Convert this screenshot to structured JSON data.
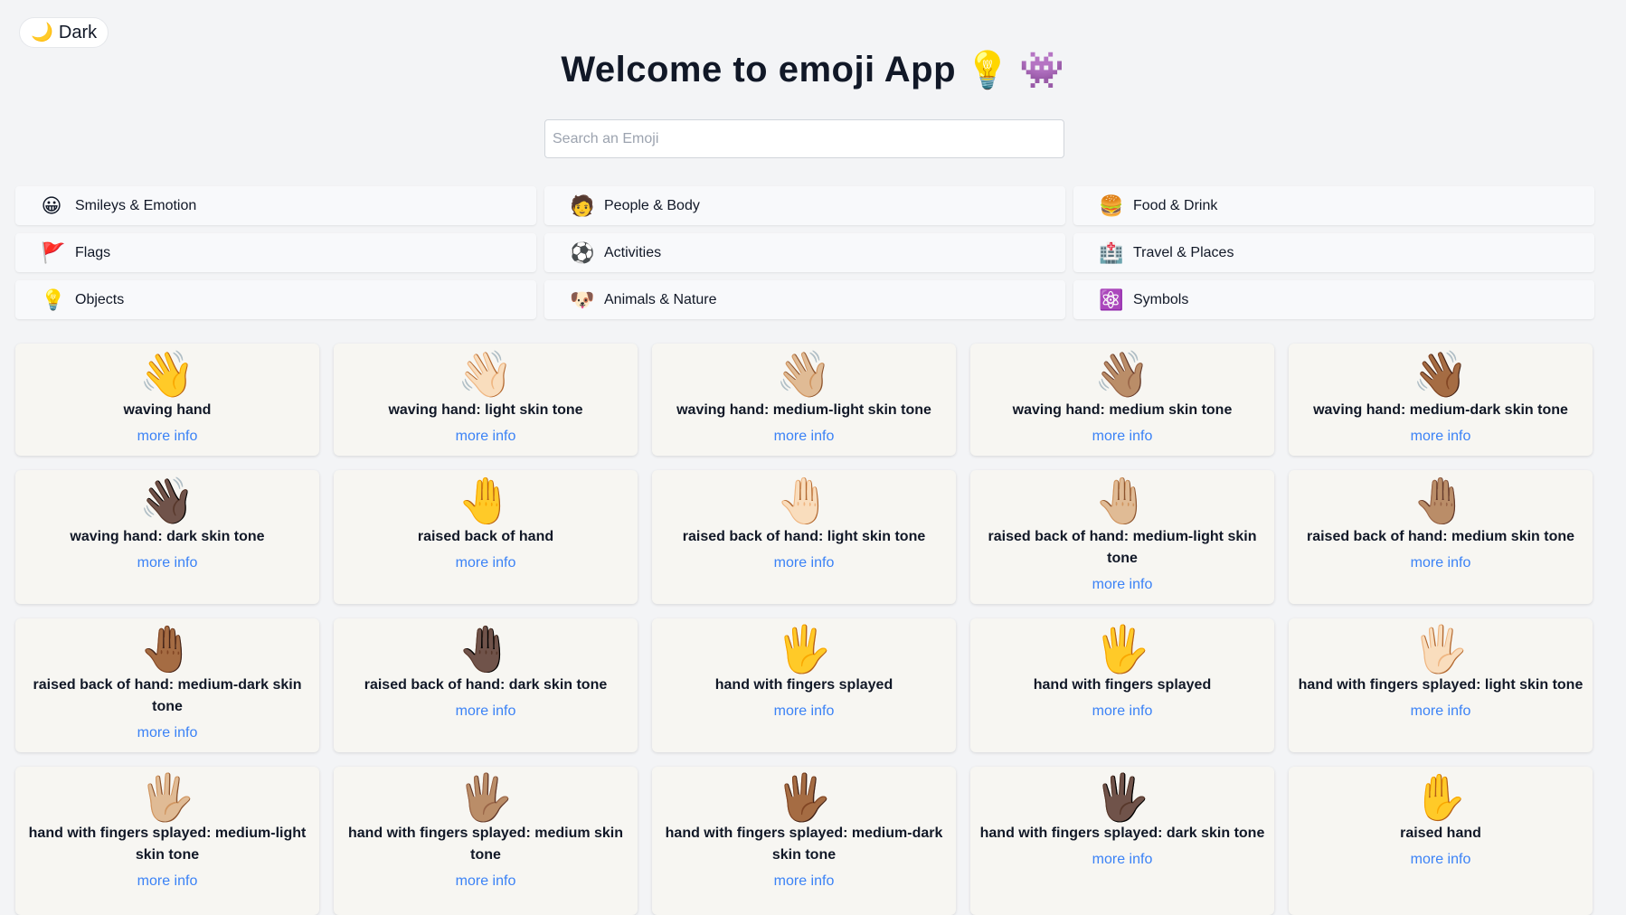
{
  "theme_toggle": {
    "icon": "🌙",
    "label": "Dark"
  },
  "header": {
    "title": "Welcome to emoji App",
    "title_emojis": [
      "💡",
      "👾"
    ]
  },
  "search": {
    "placeholder": "Search an Emoji",
    "value": ""
  },
  "categories": [
    {
      "icon": "😀",
      "label": "Smileys & Emotion"
    },
    {
      "icon": "🧑",
      "label": "People & Body"
    },
    {
      "icon": "🍔",
      "label": "Food & Drink"
    },
    {
      "icon": "🚩",
      "label": "Flags"
    },
    {
      "icon": "⚽",
      "label": "Activities"
    },
    {
      "icon": "🏥",
      "label": "Travel & Places"
    },
    {
      "icon": "💡",
      "label": "Objects"
    },
    {
      "icon": "🐶",
      "label": "Animals & Nature"
    },
    {
      "icon": "⚛️",
      "label": "Symbols"
    }
  ],
  "more_info_label": "more info",
  "emojis": [
    {
      "char": "👋",
      "name": "waving hand"
    },
    {
      "char": "👋🏻",
      "name": "waving hand: light skin tone"
    },
    {
      "char": "👋🏼",
      "name": "waving hand: medium-light skin tone"
    },
    {
      "char": "👋🏽",
      "name": "waving hand: medium skin tone"
    },
    {
      "char": "👋🏾",
      "name": "waving hand: medium-dark skin tone"
    },
    {
      "char": "👋🏿",
      "name": "waving hand: dark skin tone"
    },
    {
      "char": "🤚",
      "name": "raised back of hand"
    },
    {
      "char": "🤚🏻",
      "name": "raised back of hand: light skin tone"
    },
    {
      "char": "🤚🏼",
      "name": "raised back of hand: medium-light skin tone"
    },
    {
      "char": "🤚🏽",
      "name": "raised back of hand: medium skin tone"
    },
    {
      "char": "🤚🏾",
      "name": "raised back of hand: medium-dark skin tone"
    },
    {
      "char": "🤚🏿",
      "name": "raised back of hand: dark skin tone"
    },
    {
      "char": "🖐️",
      "name": "hand with fingers splayed"
    },
    {
      "char": "🖐",
      "name": "hand with fingers splayed"
    },
    {
      "char": "🖐🏻",
      "name": "hand with fingers splayed: light skin tone"
    },
    {
      "char": "🖐🏼",
      "name": "hand with fingers splayed: medium-light skin tone"
    },
    {
      "char": "🖐🏽",
      "name": "hand with fingers splayed: medium skin tone"
    },
    {
      "char": "🖐🏾",
      "name": "hand with fingers splayed: medium-dark skin tone"
    },
    {
      "char": "🖐🏿",
      "name": "hand with fingers splayed: dark skin tone"
    },
    {
      "char": "✋",
      "name": "raised hand"
    }
  ]
}
